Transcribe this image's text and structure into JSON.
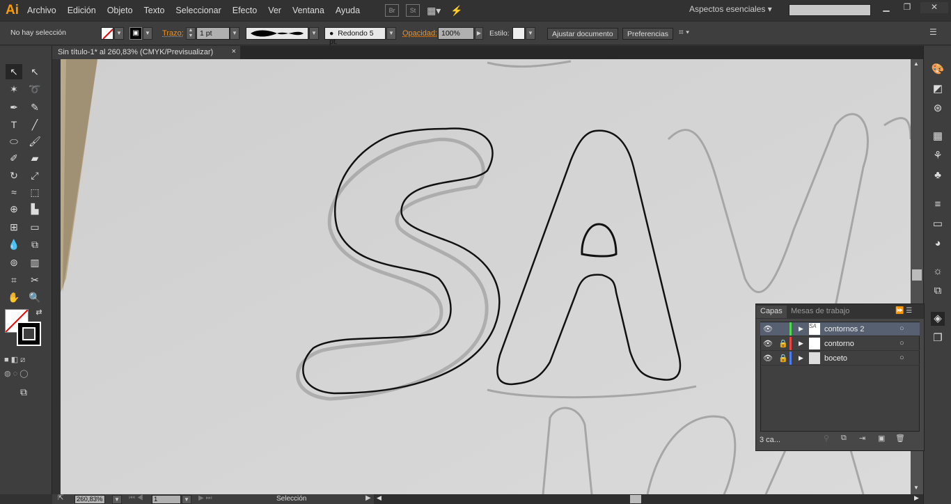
{
  "app": {
    "logo": "Ai",
    "menus": [
      "Archivo",
      "Edición",
      "Objeto",
      "Texto",
      "Seleccionar",
      "Efecto",
      "Ver",
      "Ventana",
      "Ayuda"
    ],
    "bridge": "Br",
    "stock": "St",
    "workspace": "Aspectos esenciales",
    "search_placeholder": ""
  },
  "control": {
    "selection": "No hay selección",
    "stroke_label": "Trazo:",
    "stroke_weight": "1 pt",
    "brush": "Redondo 5 pt.",
    "opacity_label": "Opacidad:",
    "opacity": "100%",
    "style_label": "Estilo:",
    "fit_button": "Ajustar documento",
    "prefs_button": "Preferencias"
  },
  "document": {
    "tab_title": "Sin título-1* al 260,83% (CMYK/Previsualizar)",
    "close": "×"
  },
  "status": {
    "zoom": "260,83%",
    "page": "1",
    "tool": "Selección"
  },
  "layers_panel": {
    "tabs": [
      "Capas",
      "Mesas de trabajo"
    ],
    "layers": [
      {
        "name": "contornos 2",
        "color": "#4ddc4d",
        "locked": false,
        "selected": true
      },
      {
        "name": "contorno",
        "color": "#ee4444",
        "locked": true,
        "selected": false
      },
      {
        "name": "boceto",
        "color": "#4c7cf0",
        "locked": true,
        "selected": false
      }
    ],
    "count": "3 ca..."
  }
}
